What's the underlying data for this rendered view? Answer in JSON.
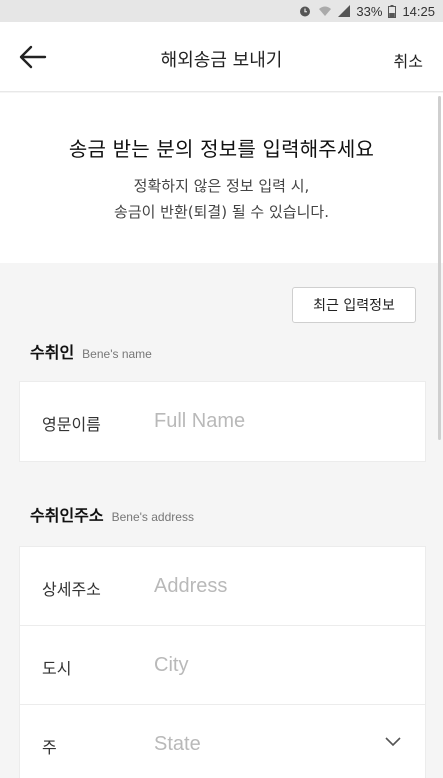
{
  "status_bar": {
    "battery": "33%",
    "time": "14:25",
    "icons": [
      "alarm-icon",
      "wifi-icon",
      "signal-icon",
      "battery-icon"
    ]
  },
  "header": {
    "back_icon": "arrow-left-icon",
    "title": "해외송금 보내기",
    "cancel_label": "취소"
  },
  "intro": {
    "heading": "송금 받는 분의 정보를 입력해주세요",
    "line1": "정확하지 않은 정보 입력 시,",
    "line2": "송금이 반환(퇴결) 될 수 있습니다."
  },
  "recent_button": "최근 입력정보",
  "beneficiary": {
    "label": "수취인",
    "label_en": "Bene's name",
    "fields": [
      {
        "label": "영문이름",
        "placeholder": "Full Name",
        "value": ""
      }
    ]
  },
  "address": {
    "label": "수취인주소",
    "label_en": "Bene's address",
    "fields": [
      {
        "label": "상세주소",
        "placeholder": "Address",
        "value": ""
      },
      {
        "label": "도시",
        "placeholder": "City",
        "value": ""
      },
      {
        "label": "주",
        "placeholder": "State",
        "value": "",
        "dropdown_icon": "chevron-down-icon"
      }
    ]
  },
  "colors": {
    "background": "#f5f5f5",
    "card": "#ffffff",
    "placeholder": "#b9b9b9",
    "text": "#222222"
  }
}
